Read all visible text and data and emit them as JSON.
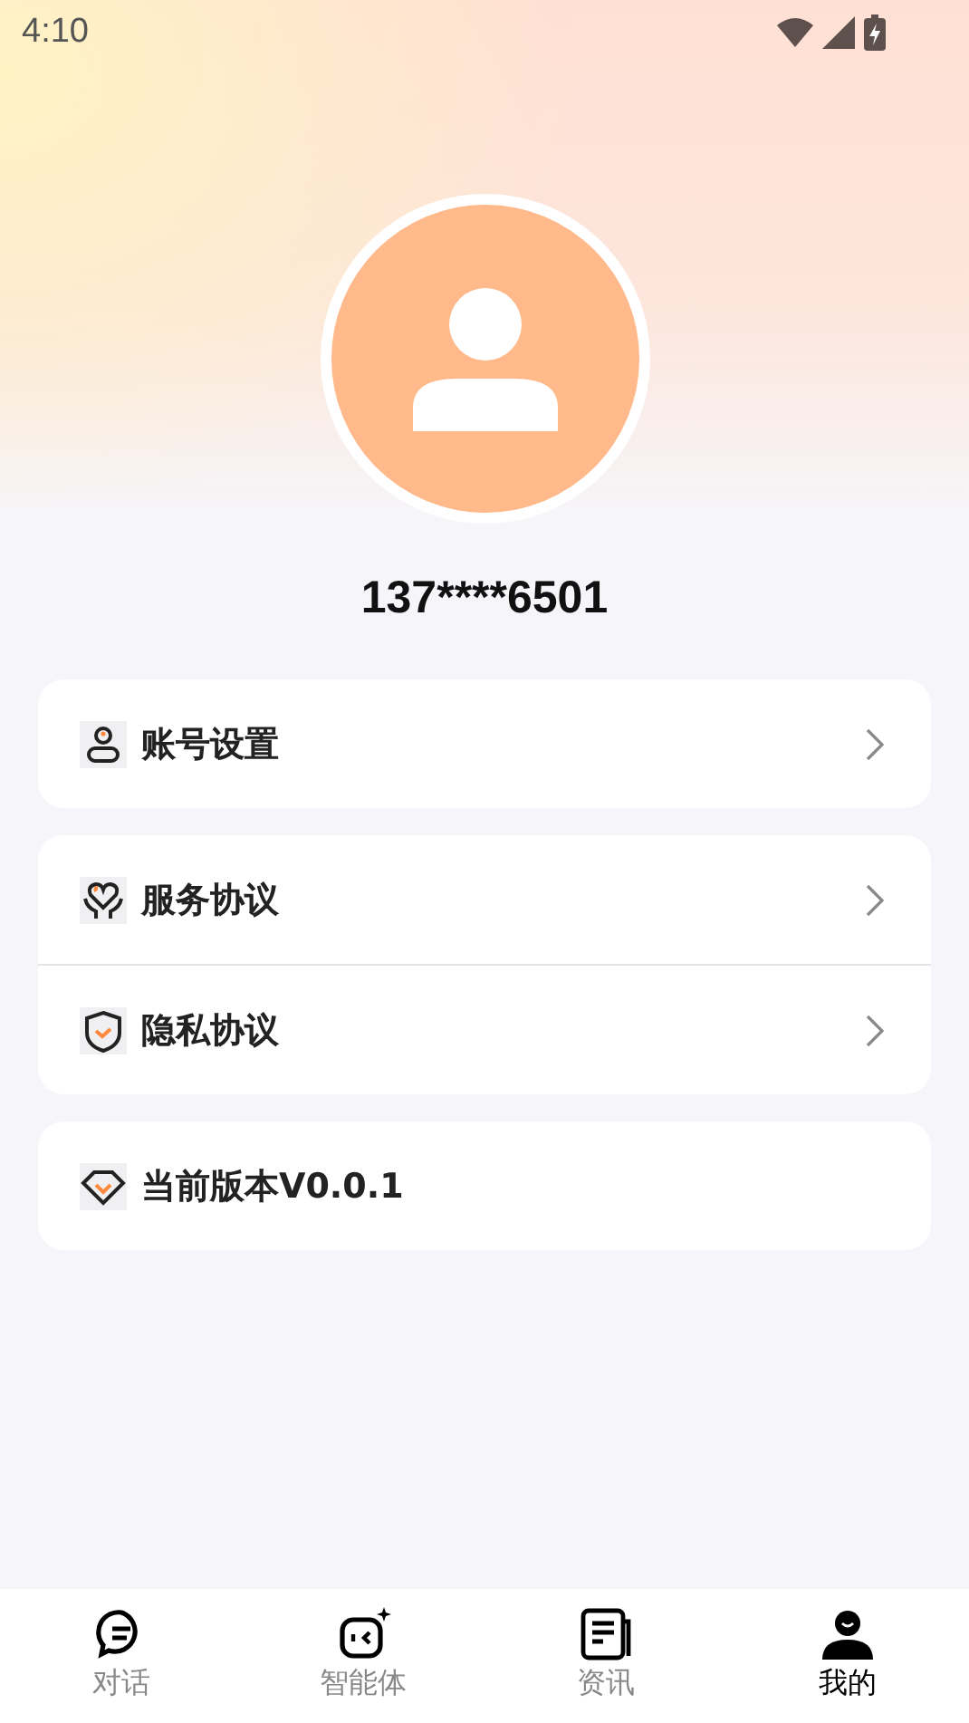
{
  "status_bar": {
    "time": "4:10"
  },
  "profile": {
    "phone": "137****6501"
  },
  "menu_groups": [
    {
      "items": [
        {
          "label": "账号设置",
          "kind": "account",
          "has_arrow": true
        }
      ]
    },
    {
      "items": [
        {
          "label": "服务协议",
          "kind": "service",
          "has_arrow": true
        },
        {
          "label": "隐私协议",
          "kind": "privacy",
          "has_arrow": true
        }
      ]
    },
    {
      "items": [
        {
          "label": "当前版本V0.0.1",
          "kind": "version",
          "has_arrow": false
        }
      ]
    }
  ],
  "tab_bar": [
    {
      "label": "对话",
      "kind": "chat",
      "selected": false
    },
    {
      "label": "智能体",
      "kind": "agent",
      "selected": false
    },
    {
      "label": "资讯",
      "kind": "news",
      "selected": false
    },
    {
      "label": "我的",
      "kind": "me",
      "selected": true
    }
  ]
}
